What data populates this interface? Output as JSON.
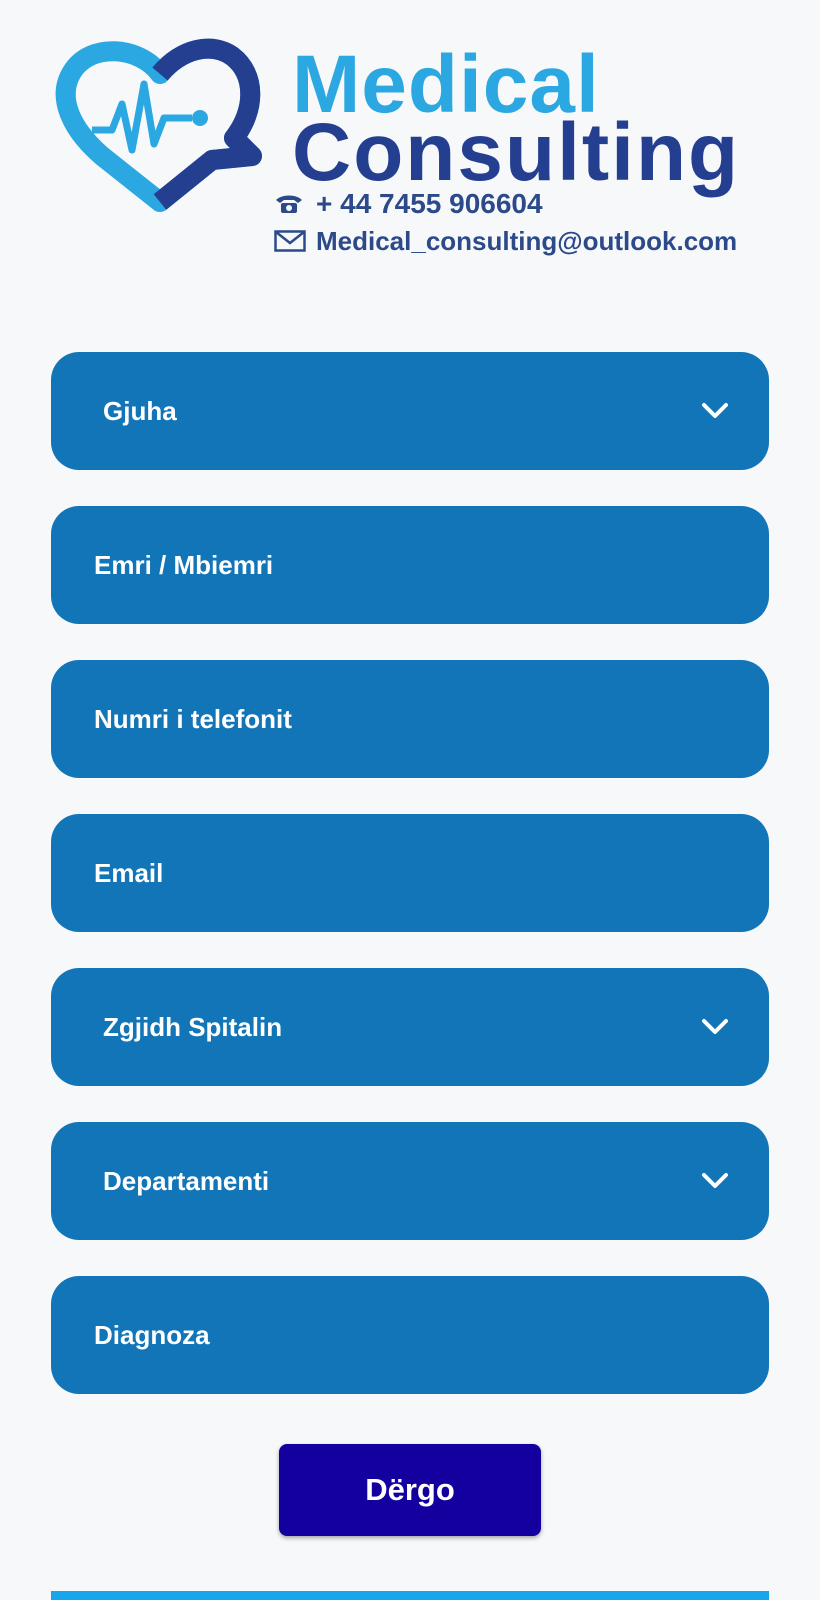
{
  "logo": {
    "line1": "Medical",
    "line2": "Consulting",
    "phone": "+ 44 7455 906604",
    "email": "Medical_consulting@outlook.com",
    "phone_icon": "telephone-icon",
    "email_icon": "envelope-icon",
    "heart_icon": "heart-heartbeat-icon"
  },
  "form": {
    "language_select": "Gjuha",
    "name_placeholder": "Emri / Mbiemri",
    "phone_placeholder": "Numri i telefonit",
    "email_placeholder": "Email",
    "hospital_select": "Zgjidh Spitalin",
    "department_select": "Departamenti",
    "diagnosis_placeholder": "Diagnoza",
    "submit_label": "Dërgo"
  },
  "colors": {
    "field_bg": "#1275b8",
    "submit_bg": "#13009e",
    "brand_light": "#2ba7e2",
    "brand_dark": "#243f8f",
    "bottom_bar": "#17a6ec"
  }
}
